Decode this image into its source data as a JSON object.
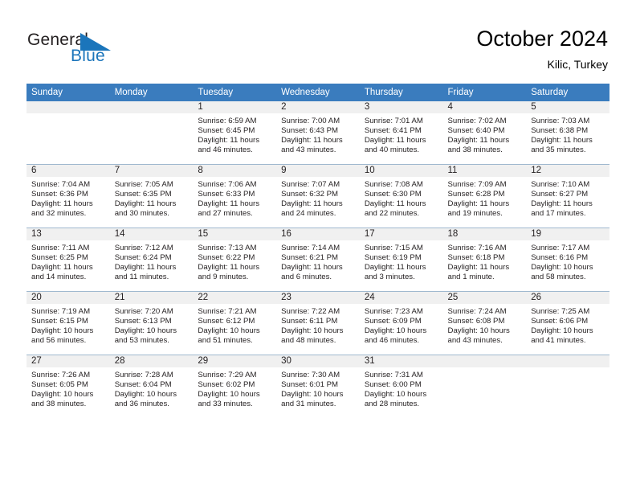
{
  "brand": {
    "name_part1": "General",
    "name_part2": "Blue",
    "accent_color": "#1b75bb",
    "header_color": "#3a7cbe"
  },
  "header": {
    "title": "October 2024",
    "subtitle": "Kilic, Turkey"
  },
  "weekday_headers": [
    "Sunday",
    "Monday",
    "Tuesday",
    "Wednesday",
    "Thursday",
    "Friday",
    "Saturday"
  ],
  "weeks": [
    [
      {
        "day": "",
        "sunrise": "",
        "sunset": "",
        "daylight_line1": "",
        "daylight_line2": ""
      },
      {
        "day": "",
        "sunrise": "",
        "sunset": "",
        "daylight_line1": "",
        "daylight_line2": ""
      },
      {
        "day": "1",
        "sunrise": "Sunrise: 6:59 AM",
        "sunset": "Sunset: 6:45 PM",
        "daylight_line1": "Daylight: 11 hours",
        "daylight_line2": "and 46 minutes."
      },
      {
        "day": "2",
        "sunrise": "Sunrise: 7:00 AM",
        "sunset": "Sunset: 6:43 PM",
        "daylight_line1": "Daylight: 11 hours",
        "daylight_line2": "and 43 minutes."
      },
      {
        "day": "3",
        "sunrise": "Sunrise: 7:01 AM",
        "sunset": "Sunset: 6:41 PM",
        "daylight_line1": "Daylight: 11 hours",
        "daylight_line2": "and 40 minutes."
      },
      {
        "day": "4",
        "sunrise": "Sunrise: 7:02 AM",
        "sunset": "Sunset: 6:40 PM",
        "daylight_line1": "Daylight: 11 hours",
        "daylight_line2": "and 38 minutes."
      },
      {
        "day": "5",
        "sunrise": "Sunrise: 7:03 AM",
        "sunset": "Sunset: 6:38 PM",
        "daylight_line1": "Daylight: 11 hours",
        "daylight_line2": "and 35 minutes."
      }
    ],
    [
      {
        "day": "6",
        "sunrise": "Sunrise: 7:04 AM",
        "sunset": "Sunset: 6:36 PM",
        "daylight_line1": "Daylight: 11 hours",
        "daylight_line2": "and 32 minutes."
      },
      {
        "day": "7",
        "sunrise": "Sunrise: 7:05 AM",
        "sunset": "Sunset: 6:35 PM",
        "daylight_line1": "Daylight: 11 hours",
        "daylight_line2": "and 30 minutes."
      },
      {
        "day": "8",
        "sunrise": "Sunrise: 7:06 AM",
        "sunset": "Sunset: 6:33 PM",
        "daylight_line1": "Daylight: 11 hours",
        "daylight_line2": "and 27 minutes."
      },
      {
        "day": "9",
        "sunrise": "Sunrise: 7:07 AM",
        "sunset": "Sunset: 6:32 PM",
        "daylight_line1": "Daylight: 11 hours",
        "daylight_line2": "and 24 minutes."
      },
      {
        "day": "10",
        "sunrise": "Sunrise: 7:08 AM",
        "sunset": "Sunset: 6:30 PM",
        "daylight_line1": "Daylight: 11 hours",
        "daylight_line2": "and 22 minutes."
      },
      {
        "day": "11",
        "sunrise": "Sunrise: 7:09 AM",
        "sunset": "Sunset: 6:28 PM",
        "daylight_line1": "Daylight: 11 hours",
        "daylight_line2": "and 19 minutes."
      },
      {
        "day": "12",
        "sunrise": "Sunrise: 7:10 AM",
        "sunset": "Sunset: 6:27 PM",
        "daylight_line1": "Daylight: 11 hours",
        "daylight_line2": "and 17 minutes."
      }
    ],
    [
      {
        "day": "13",
        "sunrise": "Sunrise: 7:11 AM",
        "sunset": "Sunset: 6:25 PM",
        "daylight_line1": "Daylight: 11 hours",
        "daylight_line2": "and 14 minutes."
      },
      {
        "day": "14",
        "sunrise": "Sunrise: 7:12 AM",
        "sunset": "Sunset: 6:24 PM",
        "daylight_line1": "Daylight: 11 hours",
        "daylight_line2": "and 11 minutes."
      },
      {
        "day": "15",
        "sunrise": "Sunrise: 7:13 AM",
        "sunset": "Sunset: 6:22 PM",
        "daylight_line1": "Daylight: 11 hours",
        "daylight_line2": "and 9 minutes."
      },
      {
        "day": "16",
        "sunrise": "Sunrise: 7:14 AM",
        "sunset": "Sunset: 6:21 PM",
        "daylight_line1": "Daylight: 11 hours",
        "daylight_line2": "and 6 minutes."
      },
      {
        "day": "17",
        "sunrise": "Sunrise: 7:15 AM",
        "sunset": "Sunset: 6:19 PM",
        "daylight_line1": "Daylight: 11 hours",
        "daylight_line2": "and 3 minutes."
      },
      {
        "day": "18",
        "sunrise": "Sunrise: 7:16 AM",
        "sunset": "Sunset: 6:18 PM",
        "daylight_line1": "Daylight: 11 hours",
        "daylight_line2": "and 1 minute."
      },
      {
        "day": "19",
        "sunrise": "Sunrise: 7:17 AM",
        "sunset": "Sunset: 6:16 PM",
        "daylight_line1": "Daylight: 10 hours",
        "daylight_line2": "and 58 minutes."
      }
    ],
    [
      {
        "day": "20",
        "sunrise": "Sunrise: 7:19 AM",
        "sunset": "Sunset: 6:15 PM",
        "daylight_line1": "Daylight: 10 hours",
        "daylight_line2": "and 56 minutes."
      },
      {
        "day": "21",
        "sunrise": "Sunrise: 7:20 AM",
        "sunset": "Sunset: 6:13 PM",
        "daylight_line1": "Daylight: 10 hours",
        "daylight_line2": "and 53 minutes."
      },
      {
        "day": "22",
        "sunrise": "Sunrise: 7:21 AM",
        "sunset": "Sunset: 6:12 PM",
        "daylight_line1": "Daylight: 10 hours",
        "daylight_line2": "and 51 minutes."
      },
      {
        "day": "23",
        "sunrise": "Sunrise: 7:22 AM",
        "sunset": "Sunset: 6:11 PM",
        "daylight_line1": "Daylight: 10 hours",
        "daylight_line2": "and 48 minutes."
      },
      {
        "day": "24",
        "sunrise": "Sunrise: 7:23 AM",
        "sunset": "Sunset: 6:09 PM",
        "daylight_line1": "Daylight: 10 hours",
        "daylight_line2": "and 46 minutes."
      },
      {
        "day": "25",
        "sunrise": "Sunrise: 7:24 AM",
        "sunset": "Sunset: 6:08 PM",
        "daylight_line1": "Daylight: 10 hours",
        "daylight_line2": "and 43 minutes."
      },
      {
        "day": "26",
        "sunrise": "Sunrise: 7:25 AM",
        "sunset": "Sunset: 6:06 PM",
        "daylight_line1": "Daylight: 10 hours",
        "daylight_line2": "and 41 minutes."
      }
    ],
    [
      {
        "day": "27",
        "sunrise": "Sunrise: 7:26 AM",
        "sunset": "Sunset: 6:05 PM",
        "daylight_line1": "Daylight: 10 hours",
        "daylight_line2": "and 38 minutes."
      },
      {
        "day": "28",
        "sunrise": "Sunrise: 7:28 AM",
        "sunset": "Sunset: 6:04 PM",
        "daylight_line1": "Daylight: 10 hours",
        "daylight_line2": "and 36 minutes."
      },
      {
        "day": "29",
        "sunrise": "Sunrise: 7:29 AM",
        "sunset": "Sunset: 6:02 PM",
        "daylight_line1": "Daylight: 10 hours",
        "daylight_line2": "and 33 minutes."
      },
      {
        "day": "30",
        "sunrise": "Sunrise: 7:30 AM",
        "sunset": "Sunset: 6:01 PM",
        "daylight_line1": "Daylight: 10 hours",
        "daylight_line2": "and 31 minutes."
      },
      {
        "day": "31",
        "sunrise": "Sunrise: 7:31 AM",
        "sunset": "Sunset: 6:00 PM",
        "daylight_line1": "Daylight: 10 hours",
        "daylight_line2": "and 28 minutes."
      },
      {
        "day": "",
        "sunrise": "",
        "sunset": "",
        "daylight_line1": "",
        "daylight_line2": ""
      },
      {
        "day": "",
        "sunrise": "",
        "sunset": "",
        "daylight_line1": "",
        "daylight_line2": ""
      }
    ]
  ]
}
